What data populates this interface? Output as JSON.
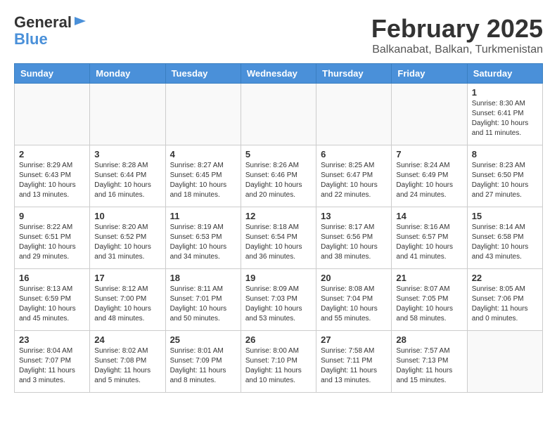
{
  "header": {
    "logo_general": "General",
    "logo_blue": "Blue",
    "month_title": "February 2025",
    "location": "Balkanabat, Balkan, Turkmenistan"
  },
  "weekdays": [
    "Sunday",
    "Monday",
    "Tuesday",
    "Wednesday",
    "Thursday",
    "Friday",
    "Saturday"
  ],
  "weeks": [
    [
      {
        "day": "",
        "info": ""
      },
      {
        "day": "",
        "info": ""
      },
      {
        "day": "",
        "info": ""
      },
      {
        "day": "",
        "info": ""
      },
      {
        "day": "",
        "info": ""
      },
      {
        "day": "",
        "info": ""
      },
      {
        "day": "1",
        "info": "Sunrise: 8:30 AM\nSunset: 6:41 PM\nDaylight: 10 hours\nand 11 minutes."
      }
    ],
    [
      {
        "day": "2",
        "info": "Sunrise: 8:29 AM\nSunset: 6:43 PM\nDaylight: 10 hours\nand 13 minutes."
      },
      {
        "day": "3",
        "info": "Sunrise: 8:28 AM\nSunset: 6:44 PM\nDaylight: 10 hours\nand 16 minutes."
      },
      {
        "day": "4",
        "info": "Sunrise: 8:27 AM\nSunset: 6:45 PM\nDaylight: 10 hours\nand 18 minutes."
      },
      {
        "day": "5",
        "info": "Sunrise: 8:26 AM\nSunset: 6:46 PM\nDaylight: 10 hours\nand 20 minutes."
      },
      {
        "day": "6",
        "info": "Sunrise: 8:25 AM\nSunset: 6:47 PM\nDaylight: 10 hours\nand 22 minutes."
      },
      {
        "day": "7",
        "info": "Sunrise: 8:24 AM\nSunset: 6:49 PM\nDaylight: 10 hours\nand 24 minutes."
      },
      {
        "day": "8",
        "info": "Sunrise: 8:23 AM\nSunset: 6:50 PM\nDaylight: 10 hours\nand 27 minutes."
      }
    ],
    [
      {
        "day": "9",
        "info": "Sunrise: 8:22 AM\nSunset: 6:51 PM\nDaylight: 10 hours\nand 29 minutes."
      },
      {
        "day": "10",
        "info": "Sunrise: 8:20 AM\nSunset: 6:52 PM\nDaylight: 10 hours\nand 31 minutes."
      },
      {
        "day": "11",
        "info": "Sunrise: 8:19 AM\nSunset: 6:53 PM\nDaylight: 10 hours\nand 34 minutes."
      },
      {
        "day": "12",
        "info": "Sunrise: 8:18 AM\nSunset: 6:54 PM\nDaylight: 10 hours\nand 36 minutes."
      },
      {
        "day": "13",
        "info": "Sunrise: 8:17 AM\nSunset: 6:56 PM\nDaylight: 10 hours\nand 38 minutes."
      },
      {
        "day": "14",
        "info": "Sunrise: 8:16 AM\nSunset: 6:57 PM\nDaylight: 10 hours\nand 41 minutes."
      },
      {
        "day": "15",
        "info": "Sunrise: 8:14 AM\nSunset: 6:58 PM\nDaylight: 10 hours\nand 43 minutes."
      }
    ],
    [
      {
        "day": "16",
        "info": "Sunrise: 8:13 AM\nSunset: 6:59 PM\nDaylight: 10 hours\nand 45 minutes."
      },
      {
        "day": "17",
        "info": "Sunrise: 8:12 AM\nSunset: 7:00 PM\nDaylight: 10 hours\nand 48 minutes."
      },
      {
        "day": "18",
        "info": "Sunrise: 8:11 AM\nSunset: 7:01 PM\nDaylight: 10 hours\nand 50 minutes."
      },
      {
        "day": "19",
        "info": "Sunrise: 8:09 AM\nSunset: 7:03 PM\nDaylight: 10 hours\nand 53 minutes."
      },
      {
        "day": "20",
        "info": "Sunrise: 8:08 AM\nSunset: 7:04 PM\nDaylight: 10 hours\nand 55 minutes."
      },
      {
        "day": "21",
        "info": "Sunrise: 8:07 AM\nSunset: 7:05 PM\nDaylight: 10 hours\nand 58 minutes."
      },
      {
        "day": "22",
        "info": "Sunrise: 8:05 AM\nSunset: 7:06 PM\nDaylight: 11 hours\nand 0 minutes."
      }
    ],
    [
      {
        "day": "23",
        "info": "Sunrise: 8:04 AM\nSunset: 7:07 PM\nDaylight: 11 hours\nand 3 minutes."
      },
      {
        "day": "24",
        "info": "Sunrise: 8:02 AM\nSunset: 7:08 PM\nDaylight: 11 hours\nand 5 minutes."
      },
      {
        "day": "25",
        "info": "Sunrise: 8:01 AM\nSunset: 7:09 PM\nDaylight: 11 hours\nand 8 minutes."
      },
      {
        "day": "26",
        "info": "Sunrise: 8:00 AM\nSunset: 7:10 PM\nDaylight: 11 hours\nand 10 minutes."
      },
      {
        "day": "27",
        "info": "Sunrise: 7:58 AM\nSunset: 7:11 PM\nDaylight: 11 hours\nand 13 minutes."
      },
      {
        "day": "28",
        "info": "Sunrise: 7:57 AM\nSunset: 7:13 PM\nDaylight: 11 hours\nand 15 minutes."
      },
      {
        "day": "",
        "info": ""
      }
    ]
  ]
}
